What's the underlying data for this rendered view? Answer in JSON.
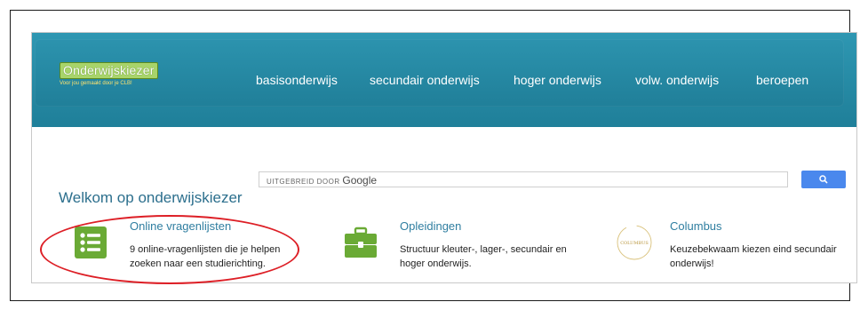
{
  "logo": {
    "name": "Onderwijskiezer",
    "tagline": "Voor jou gemaakt door je CLB!"
  },
  "nav": [
    "basisonderwijs",
    "secundair onderwijs",
    "hoger onderwijs",
    "volw. onderwijs",
    "beroepen"
  ],
  "search": {
    "brand_prefix": "UITGEBREID DOOR",
    "brand_name": "Google",
    "button_icon": "search-icon"
  },
  "welcome": "Welkom op onderwijskiezer",
  "features": [
    {
      "title": "Online vragenlijsten",
      "line1": "9 online-vragenlijsten die je helpen",
      "line2": "zoeken naar een studierichting.",
      "icon": "list-icon"
    },
    {
      "title": "Opleidingen",
      "line1": "Structuur kleuter-, lager-, secundair en",
      "line2": "hoger onderwijs.",
      "icon": "briefcase-icon"
    },
    {
      "title": "Columbus",
      "line1": "Keuzebekwaam kiezen eind secundair",
      "line2": "onderwijs!",
      "icon": "columbus-logo",
      "icon_text": "COLUMBUS"
    }
  ],
  "colors": {
    "header": "#2e97b2",
    "accent_green": "#6aaa35",
    "annotation_red": "#dd1f26",
    "search_button": "#4a88ed"
  }
}
